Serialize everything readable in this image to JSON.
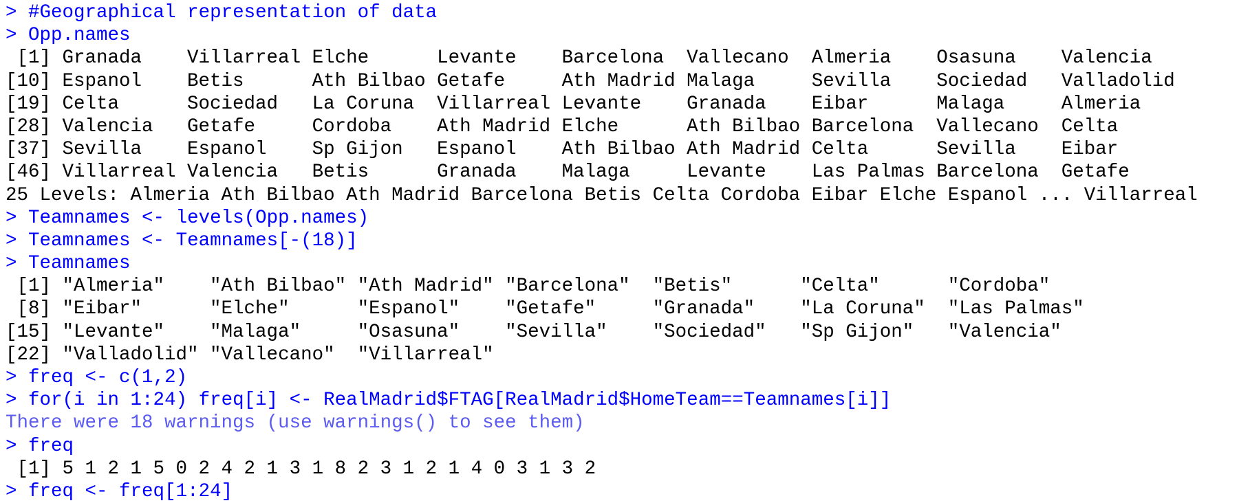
{
  "colors": {
    "background": "#ffffff",
    "input": "#0000ff",
    "output": "#000000",
    "message": "#5c5cf0"
  },
  "console": {
    "prompt": ">",
    "lines": [
      {
        "kind": "input",
        "text": "#Geographical representation of data"
      },
      {
        "kind": "input",
        "text": "Opp.names"
      },
      {
        "kind": "output",
        "text": " [1] Granada    Villarreal Elche      Levante    Barcelona  Vallecano  Almeria    Osasuna    Valencia"
      },
      {
        "kind": "output",
        "text": "[10] Espanol    Betis      Ath Bilbao Getafe     Ath Madrid Malaga     Sevilla    Sociedad   Valladolid"
      },
      {
        "kind": "output",
        "text": "[19] Celta      Sociedad   La Coruna  Villarreal Levante    Granada    Eibar      Malaga     Almeria"
      },
      {
        "kind": "output",
        "text": "[28] Valencia   Getafe     Cordoba    Ath Madrid Elche      Ath Bilbao Barcelona  Vallecano  Celta"
      },
      {
        "kind": "output",
        "text": "[37] Sevilla    Espanol    Sp Gijon   Espanol    Ath Bilbao Ath Madrid Celta      Sevilla    Eibar"
      },
      {
        "kind": "output",
        "text": "[46] Villarreal Valencia   Betis      Granada    Malaga     Levante    Las Palmas Barcelona  Getafe"
      },
      {
        "kind": "output",
        "text": "25 Levels: Almeria Ath Bilbao Ath Madrid Barcelona Betis Celta Cordoba Eibar Elche Espanol ... Villarreal"
      },
      {
        "kind": "input",
        "text": "Teamnames <- levels(Opp.names)"
      },
      {
        "kind": "input",
        "text": "Teamnames <- Teamnames[-(18)]"
      },
      {
        "kind": "input",
        "text": "Teamnames"
      },
      {
        "kind": "output",
        "text": " [1] \"Almeria\"    \"Ath Bilbao\" \"Ath Madrid\" \"Barcelona\"  \"Betis\"      \"Celta\"      \"Cordoba\""
      },
      {
        "kind": "output",
        "text": " [8] \"Eibar\"      \"Elche\"      \"Espanol\"    \"Getafe\"     \"Granada\"    \"La Coruna\"  \"Las Palmas\""
      },
      {
        "kind": "output",
        "text": "[15] \"Levante\"    \"Malaga\"     \"Osasuna\"    \"Sevilla\"    \"Sociedad\"   \"Sp Gijon\"   \"Valencia\""
      },
      {
        "kind": "output",
        "text": "[22] \"Valladolid\" \"Vallecano\"  \"Villarreal\""
      },
      {
        "kind": "input",
        "text": "freq <- c(1,2)"
      },
      {
        "kind": "input",
        "text": "for(i in 1:24) freq[i] <- RealMadrid$FTAG[RealMadrid$HomeTeam==Teamnames[i]]"
      },
      {
        "kind": "message",
        "text": "There were 18 warnings (use warnings() to see them)"
      },
      {
        "kind": "input",
        "text": "freq"
      },
      {
        "kind": "output",
        "text": " [1] 5 1 2 1 5 0 2 4 2 1 3 1 8 2 3 1 2 1 4 0 3 1 3 2"
      },
      {
        "kind": "input",
        "text": "freq <- freq[1:24]"
      }
    ]
  }
}
